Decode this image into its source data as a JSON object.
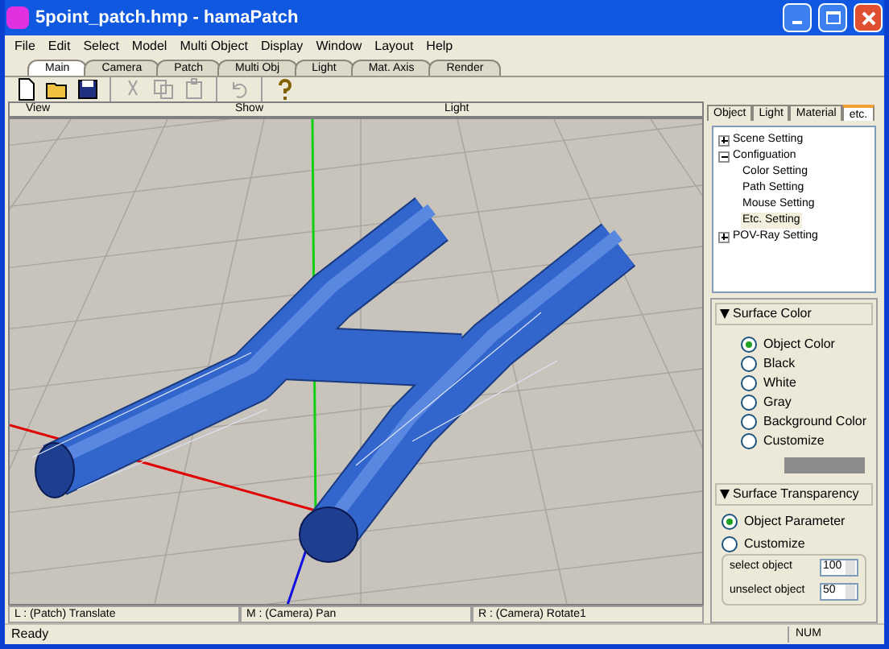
{
  "window": {
    "title": "5point_patch.hmp - hamaPatch"
  },
  "menu": [
    "File",
    "Edit",
    "Select",
    "Model",
    "Multi Object",
    "Display",
    "Window",
    "Layout",
    "Help"
  ],
  "tabs": [
    {
      "label": "Main",
      "selected": true
    },
    {
      "label": "Camera",
      "selected": false
    },
    {
      "label": "Patch",
      "selected": false
    },
    {
      "label": "Multi Obj",
      "selected": false
    },
    {
      "label": "Light",
      "selected": false
    },
    {
      "label": "Mat. Axis",
      "selected": false
    },
    {
      "label": "Render",
      "selected": false
    }
  ],
  "toolbar": [
    {
      "kind": "new",
      "disabled": false
    },
    {
      "kind": "open",
      "disabled": false
    },
    {
      "kind": "save",
      "disabled": false
    },
    {
      "kind": "sep"
    },
    {
      "kind": "cut",
      "disabled": true
    },
    {
      "kind": "copy",
      "disabled": true
    },
    {
      "kind": "paste",
      "disabled": true
    },
    {
      "kind": "sep"
    },
    {
      "kind": "undo",
      "disabled": true
    },
    {
      "kind": "sep"
    },
    {
      "kind": "help",
      "disabled": false
    }
  ],
  "viewport": {
    "menus": [
      "View",
      "Show",
      "Light"
    ],
    "hints": [
      "L : (Patch) Translate",
      "M : (Camera) Pan",
      "R : (Camera) Rotate1"
    ]
  },
  "panel": {
    "tabs": [
      {
        "label": "Object",
        "selected": false
      },
      {
        "label": "Light",
        "selected": false
      },
      {
        "label": "Material",
        "selected": false
      },
      {
        "label": "etc.",
        "selected": true
      }
    ],
    "tree": [
      {
        "label": "Scene Setting",
        "expanded": false,
        "selected": false
      },
      {
        "label": "Configuation",
        "expanded": true,
        "selected": false,
        "children": [
          {
            "label": "Color Setting",
            "selected": false
          },
          {
            "label": "Path Setting",
            "selected": false
          },
          {
            "label": "Mouse Setting",
            "selected": false
          },
          {
            "label": "Etc. Setting",
            "selected": true
          }
        ]
      },
      {
        "label": "POV-Ray Setting",
        "expanded": false,
        "selected": false
      }
    ],
    "surface_color": {
      "title": "Surface Color",
      "options": [
        {
          "label": "Object Color",
          "selected": true
        },
        {
          "label": "Black",
          "selected": false
        },
        {
          "label": "White",
          "selected": false
        },
        {
          "label": "Gray",
          "selected": false
        },
        {
          "label": "Background Color",
          "selected": false
        },
        {
          "label": "Customize",
          "selected": false
        }
      ]
    },
    "surface_transparency": {
      "title": "Surface Transparency",
      "options": [
        {
          "label": "Object Parameter",
          "selected": true
        },
        {
          "label": "Customize",
          "selected": false
        }
      ],
      "fields": [
        {
          "label": "select object",
          "value": "100"
        },
        {
          "label": "unselect object",
          "value": "50"
        }
      ]
    }
  },
  "status_bar": {
    "text": "Ready",
    "indicator": "NUM"
  }
}
